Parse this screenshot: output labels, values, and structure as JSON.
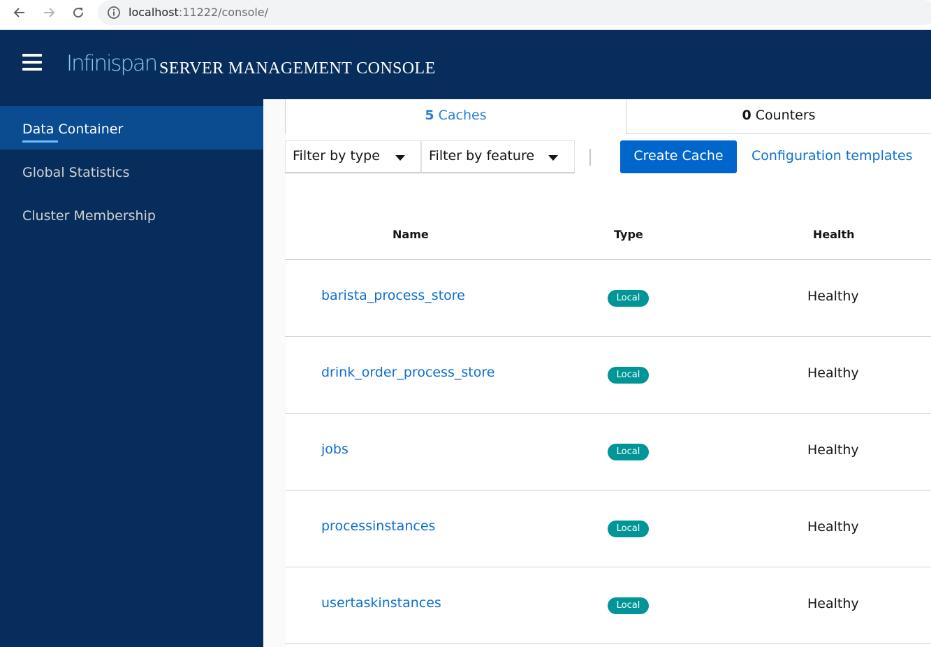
{
  "browser": {
    "url_host": "localhost",
    "url_rest": ":11222/console/"
  },
  "header": {
    "logo_text": "Infinispan",
    "title": "SERVER MANAGEMENT CONSOLE"
  },
  "sidebar": {
    "items": [
      {
        "label": "Data Container",
        "active": true
      },
      {
        "label": "Global Statistics",
        "active": false
      },
      {
        "label": "Cluster Membership",
        "active": false
      }
    ]
  },
  "tabs": [
    {
      "count": "5",
      "label": "Caches",
      "active": true
    },
    {
      "count": "0",
      "label": "Counters",
      "active": false
    }
  ],
  "toolbar": {
    "filter_type": "Filter by type",
    "filter_feature": "Filter by feature",
    "create_label": "Create Cache",
    "templates_label": "Configuration templates"
  },
  "table": {
    "headers": [
      "Name",
      "Type",
      "Health"
    ],
    "rows": [
      {
        "name": "barista_process_store",
        "type": "Local",
        "health": "Healthy"
      },
      {
        "name": "drink_order_process_store",
        "type": "Local",
        "health": "Healthy"
      },
      {
        "name": "jobs",
        "type": "Local",
        "health": "Healthy"
      },
      {
        "name": "processinstances",
        "type": "Local",
        "health": "Healthy"
      },
      {
        "name": "usertaskinstances",
        "type": "Local",
        "health": "Healthy"
      }
    ]
  },
  "colors": {
    "masthead": "#062d5c",
    "sidebar_active": "#0b4b90",
    "primary": "#0066cc",
    "link": "#0b6fd0",
    "badge": "#009596"
  }
}
